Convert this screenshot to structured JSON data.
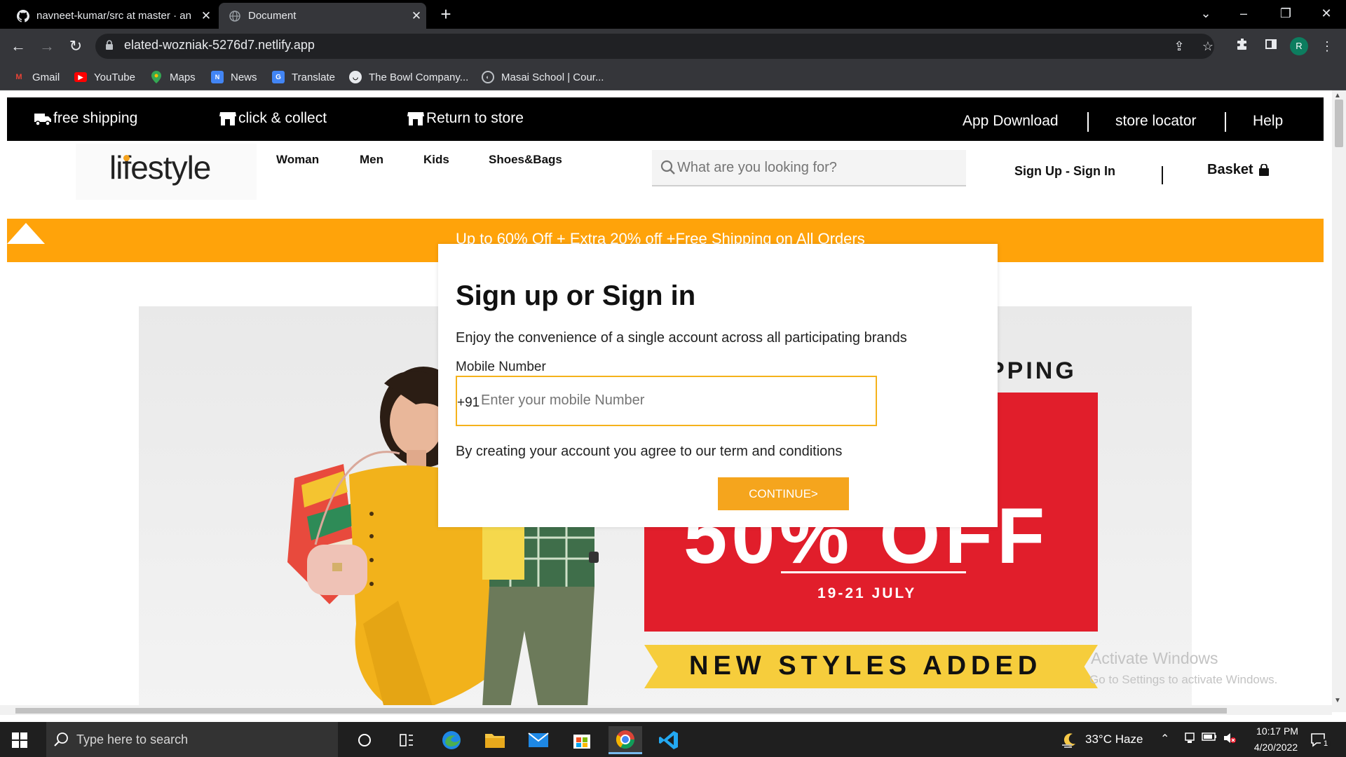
{
  "browser": {
    "tabs": [
      {
        "title": "navneet-kumar/src at master · an",
        "icon": "github-icon"
      },
      {
        "title": "Document",
        "icon": "globe-icon"
      }
    ],
    "url": "elated-wozniak-5276d7.netlify.app",
    "profile_initial": "R",
    "bookmarks": [
      {
        "label": "Gmail",
        "icon": "gmail-icon"
      },
      {
        "label": "YouTube",
        "icon": "youtube-icon"
      },
      {
        "label": "Maps",
        "icon": "maps-icon"
      },
      {
        "label": "News",
        "icon": "news-icon"
      },
      {
        "label": "Translate",
        "icon": "translate-icon"
      },
      {
        "label": "The Bowl Company...",
        "icon": "bowl-icon"
      },
      {
        "label": "Masai School | Cour...",
        "icon": "masai-icon"
      }
    ]
  },
  "site": {
    "topbar": {
      "left_items": [
        "free shipping",
        "click & collect",
        "Return to store"
      ],
      "right_items": [
        "App Download",
        "store locator",
        "Help"
      ]
    },
    "logo": "lifestyle",
    "nav": [
      "Woman",
      "Men",
      "Kids",
      "Shoes&Bags"
    ],
    "search_placeholder": "What are you looking for?",
    "signup": "Sign Up - Sign In",
    "basket": "Basket",
    "banner": "Up to 60% Off + Extra 20% off +Free Shipping on All Orders",
    "promo": {
      "heading_fragment": "PPING",
      "big_text": "50% OFF",
      "date": "19-21 JULY",
      "ribbon": "NEW STYLES ADDED"
    }
  },
  "modal": {
    "title": "Sign up or Sign in",
    "subtitle": "Enjoy the convenience of a single account across all participating brands",
    "mobile_label": "Mobile Number",
    "country_code": "+91",
    "mobile_placeholder": "Enter your mobile Number",
    "terms": "By creating your account you agree to our term and conditions",
    "continue_label": "CONTINUE>"
  },
  "watermark": {
    "line1": "Activate Windows",
    "line2": "Go to Settings to activate Windows."
  },
  "taskbar": {
    "search_placeholder": "Type here to search",
    "weather": "33°C  Haze",
    "time": "10:17 PM",
    "date": "4/20/2022",
    "notification_count": "1"
  },
  "colors": {
    "accent_orange": "#ffa30a",
    "button_orange": "#f5a51d",
    "promo_red": "#e11e2b",
    "ribbon_yellow": "#f6cd3c"
  }
}
